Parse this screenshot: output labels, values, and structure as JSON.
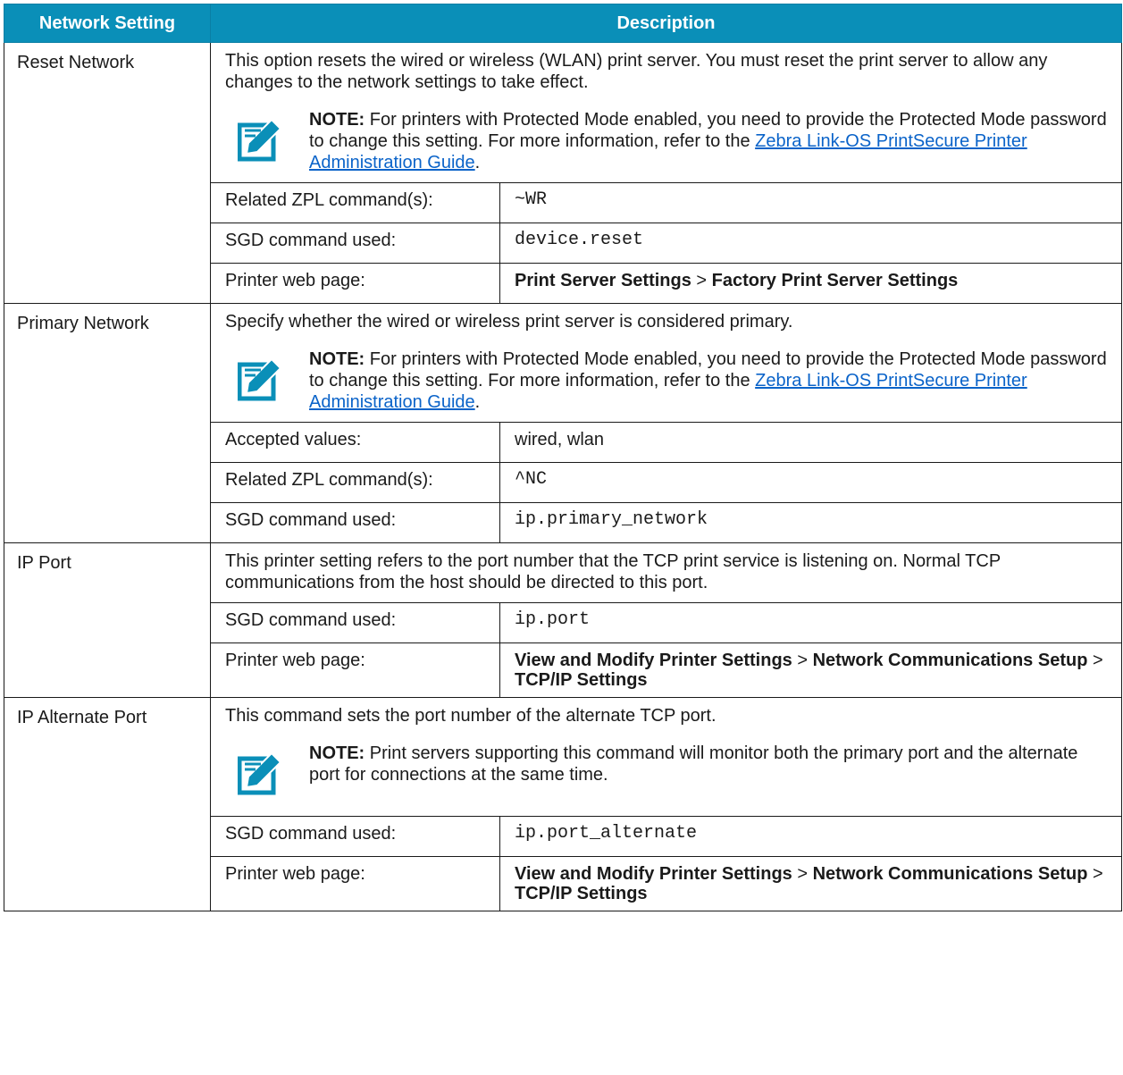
{
  "header": {
    "col1": "Network Setting",
    "col2": "Description"
  },
  "rows": [
    {
      "setting": "Reset Network",
      "desc": "This option resets the wired or wireless (WLAN) print server. You must reset the print server to allow any changes to the network settings to take effect.",
      "note": {
        "label": "NOTE:",
        "text": "For printers with Protected Mode enabled, you need to provide the Protected Mode password to change this setting. For more information, refer to the",
        "link": "Zebra Link-OS PrintSecure Printer Administration Guide",
        "end": "."
      },
      "sub": [
        {
          "k": "Related ZPL command(s):",
          "v": "~WR"
        },
        {
          "k": "SGD command used:",
          "v": "device.reset"
        },
        {
          "k": "Printer web page:",
          "v1": "Print Server Settings",
          "sep1": " > ",
          "v2": "Factory Print Server Settings"
        }
      ]
    },
    {
      "setting": "Primary Network",
      "desc": "Specify whether the wired or wireless print server is considered primary.",
      "note": {
        "label": "NOTE:",
        "text": "For printers with Protected Mode enabled, you need to provide the Protected Mode password to change this setting. For more information, refer to the",
        "link": "Zebra Link-OS PrintSecure Printer Administration Guide",
        "end": "."
      },
      "sub": [
        {
          "k": "Accepted values:",
          "v": "wired, wlan"
        },
        {
          "k": "Related ZPL command(s):",
          "v": "^NC"
        },
        {
          "k": "SGD command used:",
          "v": "ip.primary_network"
        }
      ]
    },
    {
      "setting": "IP Port",
      "desc": "This printer setting refers to the port number that the TCP print service is listening on. Normal TCP communications from the host should be directed to this port.",
      "sub": [
        {
          "k": "SGD command used:",
          "v": "ip.port"
        },
        {
          "k": "Printer web page:",
          "v1": "View and Modify Printer Settings",
          "sep1": " > ",
          "v2": "Network Communications Setup",
          "sep2": " > ",
          "v3": "TCP/IP Settings"
        }
      ]
    },
    {
      "setting": "IP Alternate Port",
      "desc": "This command sets the port number of the alternate TCP port.",
      "note": {
        "label": "NOTE:",
        "text": "Print servers supporting this command will monitor both the primary port and the alternate port for connections at the same time."
      },
      "sub": [
        {
          "k": "SGD command used:",
          "v": "ip.port_alternate"
        },
        {
          "k": "Printer web page:",
          "v1": "View and Modify Printer Settings",
          "sep1": " > ",
          "v2": "Network Communications Setup",
          "sep2": " > ",
          "v3": "TCP/IP Settings"
        }
      ]
    }
  ],
  "colors": {
    "header_bg": "#0a8fb8",
    "note_icon": "#0a8fb8",
    "link": "#0a63c9"
  },
  "icons": {
    "note": "pencil-note-icon"
  }
}
